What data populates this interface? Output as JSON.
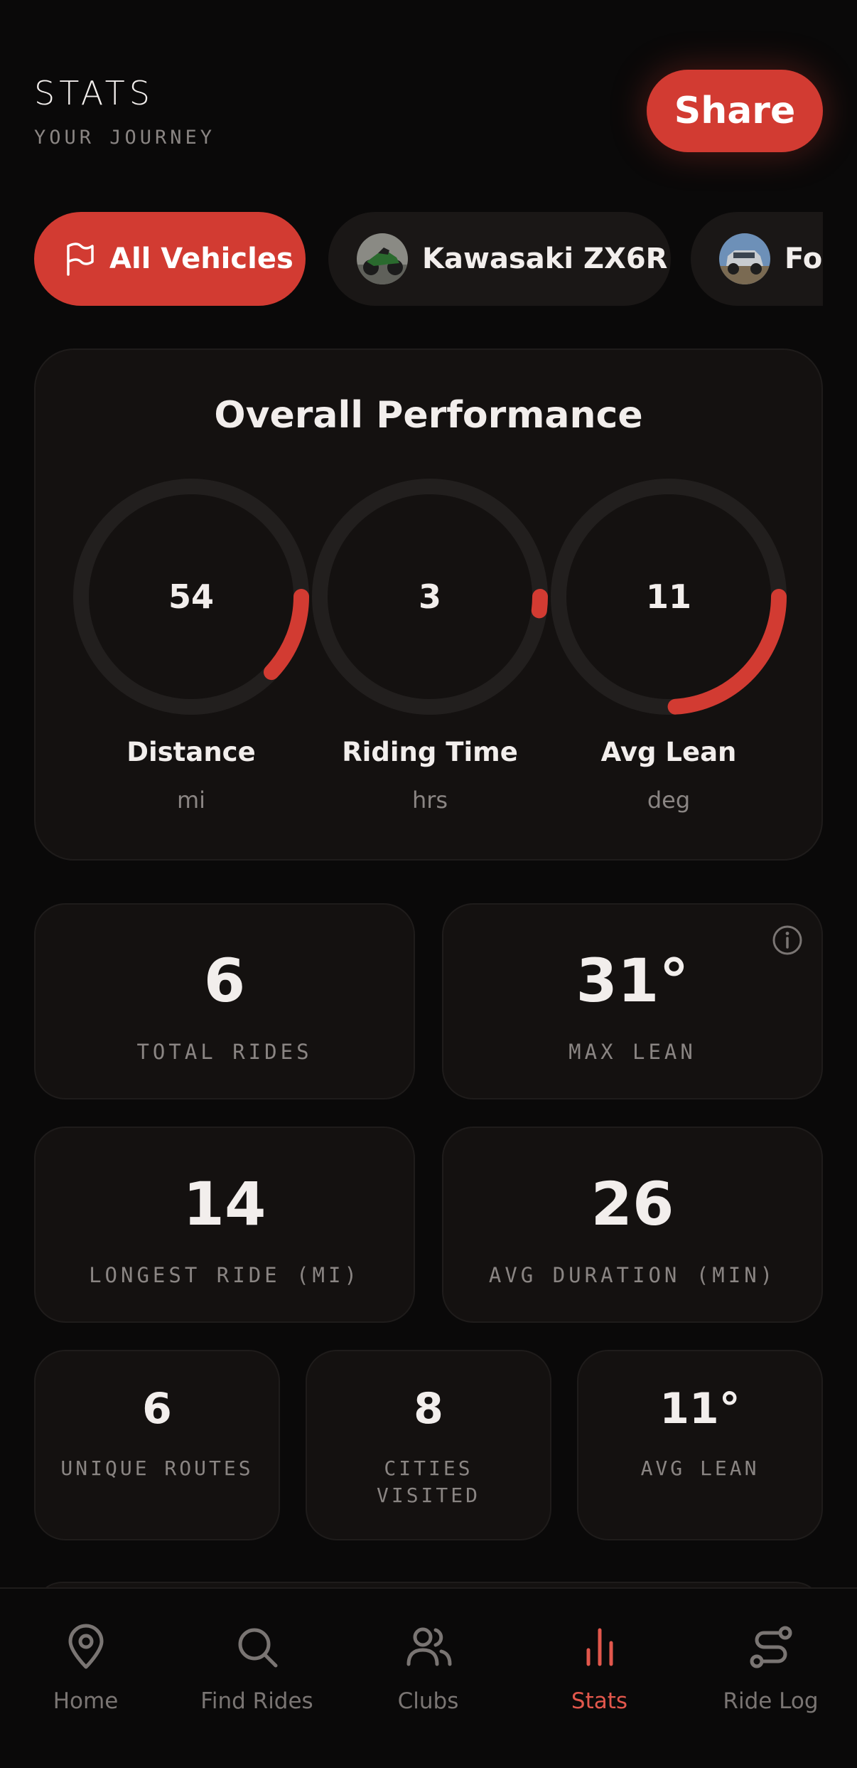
{
  "header": {
    "title": "STATS",
    "subtitle": "YOUR JOURNEY",
    "share_label": "Share"
  },
  "vehicle_chips": [
    {
      "label": "All Vehicles",
      "icon": "flag-icon",
      "active": true
    },
    {
      "label": "Kawasaki ZX6R",
      "icon": "motorcycle-avatar",
      "active": false
    },
    {
      "label": "For",
      "icon": "truck-avatar",
      "active": false
    }
  ],
  "overall": {
    "title": "Overall Performance",
    "gauges": [
      {
        "value": "54",
        "label": "Distance",
        "unit": "mi",
        "fill": 0.12
      },
      {
        "value": "3",
        "label": "Riding Time",
        "unit": "hrs",
        "fill": 0.02
      },
      {
        "value": "11",
        "label": "Avg Lean",
        "unit": "deg",
        "fill": 0.24
      }
    ]
  },
  "stats": {
    "total_rides": {
      "value": "6",
      "label": "TOTAL RIDES"
    },
    "max_lean": {
      "value": "31°",
      "label": "MAX LEAN"
    },
    "longest_ride": {
      "value": "14",
      "label": "LONGEST RIDE (MI)"
    },
    "avg_duration": {
      "value": "26",
      "label": "AVG DURATION (MIN)"
    },
    "unique_routes": {
      "value": "6",
      "label": "UNIQUE ROUTES"
    },
    "cities_visited": {
      "value": "8",
      "label_line1": "CITIES",
      "label_line2": "VISITED"
    },
    "avg_lean": {
      "value": "11°",
      "label": "AVG LEAN"
    }
  },
  "nav": [
    {
      "label": "Home",
      "icon": "map-pin-icon"
    },
    {
      "label": "Find Rides",
      "icon": "search-icon"
    },
    {
      "label": "Clubs",
      "icon": "users-icon"
    },
    {
      "label": "Stats",
      "icon": "bar-chart-icon",
      "active": true
    },
    {
      "label": "Ride Log",
      "icon": "route-icon"
    }
  ],
  "colors": {
    "accent": "#d23b32",
    "background": "#0a0909",
    "card": "#141110",
    "track": "#221f1e"
  }
}
